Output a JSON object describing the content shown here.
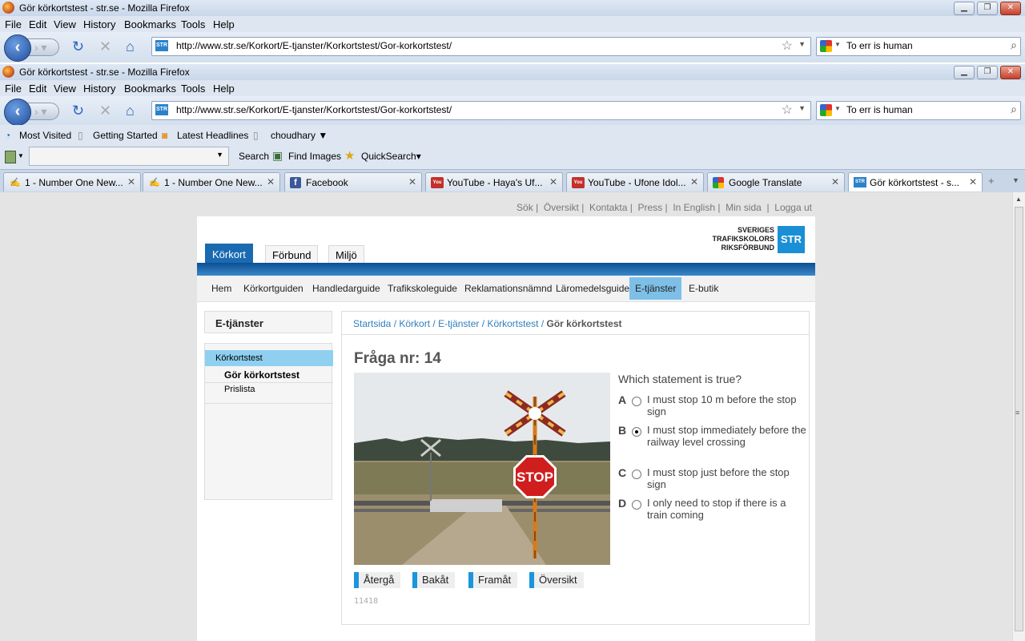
{
  "window": {
    "title": "Gör körkortstest - str.se - Mozilla Firefox"
  },
  "menu": [
    "File",
    "Edit",
    "View",
    "History",
    "Bookmarks",
    "Tools",
    "Help"
  ],
  "nav": {
    "url": "http://www.str.se/Korkort/E-tjanster/Korkortstest/Gor-korkortstest/",
    "search_value": "To err is human"
  },
  "bookmarks": [
    "Most Visited",
    "Getting Started",
    "Latest Headlines",
    "choudhary ▼"
  ],
  "toolbar2": {
    "search_label": "Search",
    "find_images": "Find Images",
    "quicksearch": "QuickSearch▾"
  },
  "tabs": [
    {
      "label": "1 - Number One New...",
      "icon": "sketch-icon"
    },
    {
      "label": "1 - Number One New...",
      "icon": "sketch-icon"
    },
    {
      "label": "Facebook",
      "icon": "facebook-icon"
    },
    {
      "label": "YouTube - Haya's Uf...",
      "icon": "youtube-icon"
    },
    {
      "label": "YouTube - Ufone Idol...",
      "icon": "youtube-icon"
    },
    {
      "label": "Google Translate",
      "icon": "google-icon"
    },
    {
      "label": "Gör körkortstest - s...",
      "icon": "str-icon"
    }
  ],
  "site": {
    "top_links": [
      "Sök",
      "Översikt",
      "Kontakta",
      "Press",
      "In English",
      "Min sida",
      "Logga ut"
    ],
    "logo_lines": [
      "SVERIGES",
      "TRAFIKSKOLORS",
      "RIKSFÖRBUND"
    ],
    "logo_mark": "STR",
    "main_tabs": [
      "Körkort",
      "Förbund",
      "Miljö"
    ],
    "sub_nav": [
      "Hem",
      "Körkortguiden",
      "Handledarguide",
      "Trafikskoleguide",
      "Reklamationsnämnd",
      "Läromedelsguide",
      "E-tjänster",
      "E-butik"
    ],
    "sidebar": {
      "heading": "E-tjänster",
      "section": "Körkortstest",
      "items": [
        "Gör körkortstest",
        "Prislista"
      ]
    },
    "breadcrumb": {
      "links": [
        "Startsida",
        "Körkort",
        "E-tjänster",
        "Körkortstest"
      ],
      "current": "Gör körkortstest"
    },
    "question_title": "Fråga nr: 14",
    "question": "Which statement is true?",
    "answers": [
      {
        "letter": "A",
        "text": "I must stop 10 m before the stop sign",
        "selected": false
      },
      {
        "letter": "B",
        "text": "I must stop immediately before the railway level crossing",
        "selected": true
      },
      {
        "letter": "C",
        "text": "I must stop just before the stop sign",
        "selected": false
      },
      {
        "letter": "D",
        "text": "I only need to stop if there is a train coming",
        "selected": false
      }
    ],
    "stop_sign_text": "STOP",
    "buttons": [
      "Återgå",
      "Bakåt",
      "Framåt",
      "Översikt"
    ],
    "counter": "11418"
  },
  "colors": {
    "accent_blue": "#1b95dc",
    "nav_blue": "#0c4f93",
    "link_blue": "#2f7fbe"
  }
}
